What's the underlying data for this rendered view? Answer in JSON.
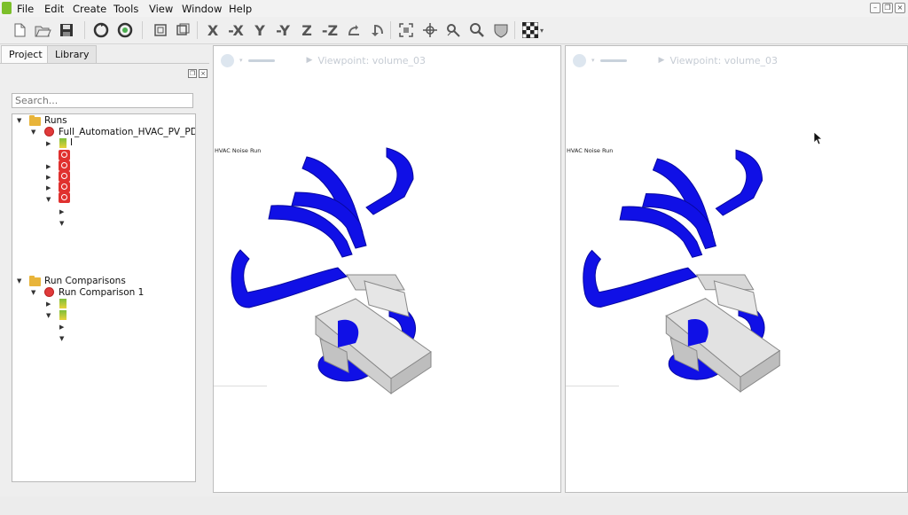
{
  "menubar": {
    "items": [
      "File",
      "Edit",
      "Create",
      "Tools",
      "View",
      "Window",
      "Help"
    ]
  },
  "toolbar": {
    "icons": [
      "new-file-icon",
      "open-folder-icon",
      "save-icon",
      "refresh-icon",
      "refresh-green-icon",
      "frame-icon",
      "window-icon",
      "view-x-icon",
      "view-neg-x-icon",
      "view-y-icon",
      "view-neg-y-icon",
      "view-z-icon",
      "view-neg-z-icon",
      "rotate-left-icon",
      "rotate-right-icon",
      "fit-icon",
      "pan-icon",
      "zoom-region-icon",
      "zoom-icon",
      "shield-icon",
      "checkerboard-icon"
    ]
  },
  "tabs": {
    "project": "Project",
    "library": "Library"
  },
  "search": {
    "placeholder": "Search..."
  },
  "tree": {
    "runs_label": "Runs",
    "run_name": "Full_Automation_HVAC_PV_PD",
    "child_label": "I",
    "comparisons_label": "Run Comparisons",
    "comparison_name": "Run Comparison 1"
  },
  "viewports": [
    {
      "viewpoint": "Viewpoint: volume_03",
      "run_label": "HVAC Noise Run"
    },
    {
      "viewpoint": "Viewpoint: volume_03",
      "run_label": "HVAC Noise Run"
    }
  ],
  "colors": {
    "duct_blue": "#1010e6",
    "body_gray": "#c8c8c8",
    "accent_red": "#e0312f",
    "folder": "#e8b43a"
  }
}
